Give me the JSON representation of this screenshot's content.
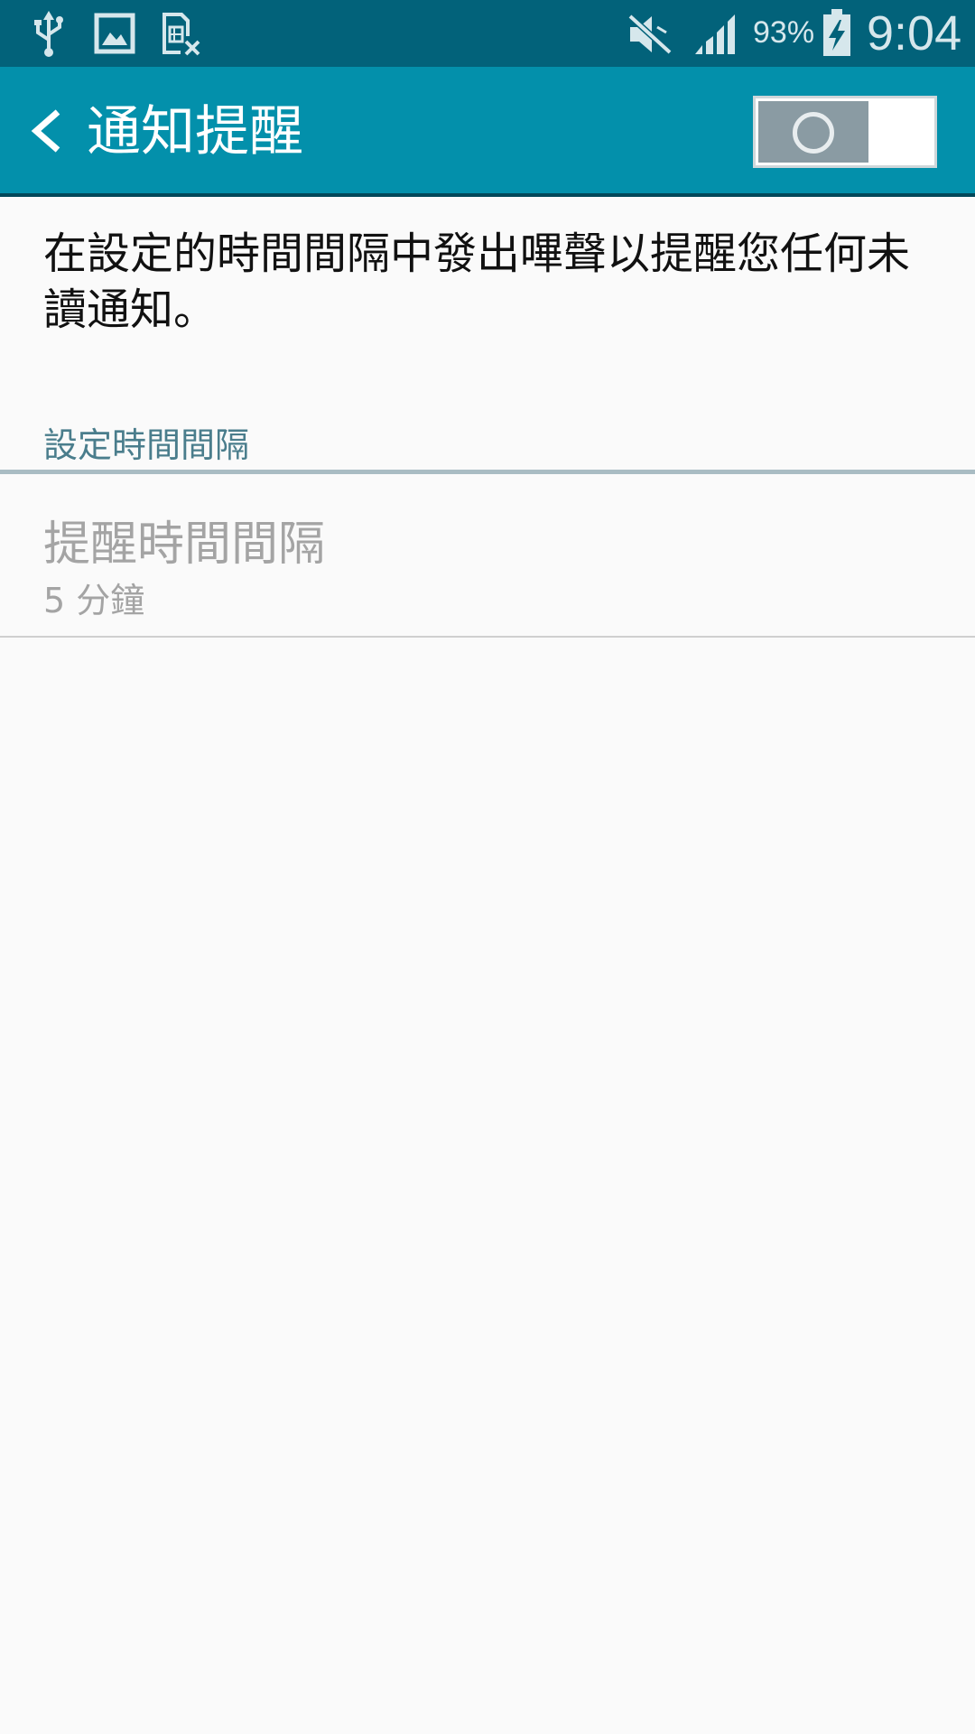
{
  "status_bar": {
    "battery_percent": "93%",
    "time": "9:04",
    "icons": [
      "usb-icon",
      "image-icon",
      "no-sim-icon",
      "mute-icon",
      "signal-icon",
      "battery-charging-icon"
    ]
  },
  "app_bar": {
    "title": "通知提醒",
    "back_icon": "chevron-left-icon",
    "master_switch_on": false
  },
  "description": "在設定的時間間隔中發出嗶聲以提醒您任何未讀通知。",
  "section": {
    "header": "設定時間間隔",
    "items": [
      {
        "title": "提醒時間間隔",
        "summary": "5 分鐘",
        "enabled": false
      }
    ]
  },
  "colors": {
    "status_bar": "#02627a",
    "app_bar": "#0390ab",
    "section_header": "#4a7d8c",
    "disabled_text": "#a4a4a4",
    "background": "#fafafa"
  }
}
